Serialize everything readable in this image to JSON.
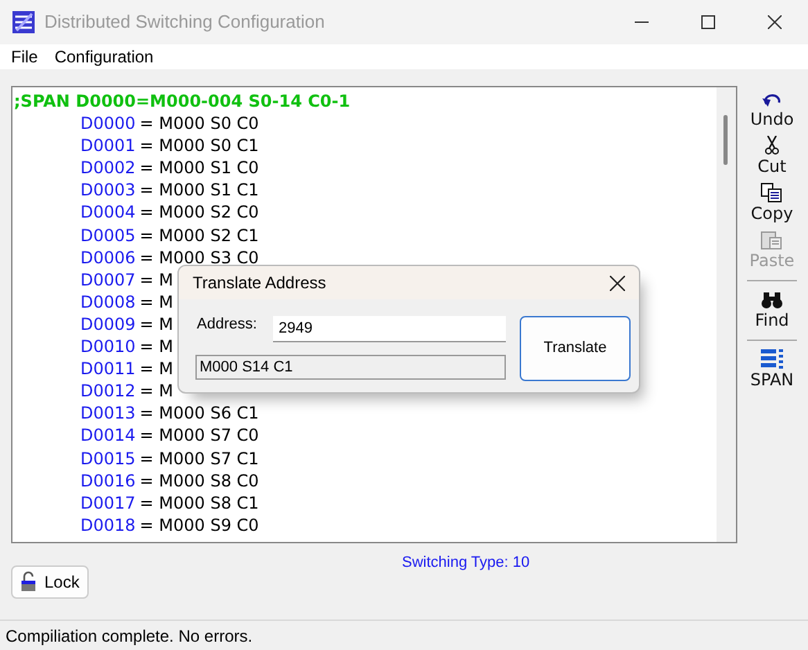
{
  "window": {
    "title": "Distributed Switching Configuration"
  },
  "menu": [
    {
      "label": "File"
    },
    {
      "label": "Configuration"
    }
  ],
  "editor": {
    "header": ";SPAN D0000=M000-004 S0-14 C0-1",
    "lines": [
      {
        "address": "D0000",
        "value": "= M000 S0 C0"
      },
      {
        "address": "D0001",
        "value": "= M000 S0 C1"
      },
      {
        "address": "D0002",
        "value": "= M000 S1 C0"
      },
      {
        "address": "D0003",
        "value": "= M000 S1 C1"
      },
      {
        "address": "D0004",
        "value": "= M000 S2 C0"
      },
      {
        "address": "D0005",
        "value": "= M000 S2 C1"
      },
      {
        "address": "D0006",
        "value": "= M000 S3 C0"
      },
      {
        "address": "D0007",
        "value": "= M"
      },
      {
        "address": "D0008",
        "value": "= M"
      },
      {
        "address": "D0009",
        "value": "= M"
      },
      {
        "address": "D0010",
        "value": "= M"
      },
      {
        "address": "D0011",
        "value": "= M"
      },
      {
        "address": "D0012",
        "value": "= M"
      },
      {
        "address": "D0013",
        "value": "= M000 S6 C1"
      },
      {
        "address": "D0014",
        "value": "= M000 S7 C0"
      },
      {
        "address": "D0015",
        "value": "= M000 S7 C1"
      },
      {
        "address": "D0016",
        "value": "= M000 S8 C0"
      },
      {
        "address": "D0017",
        "value": "= M000 S8 C1"
      },
      {
        "address": "D0018",
        "value": "= M000 S9 C0"
      }
    ]
  },
  "toolbar": [
    {
      "kind": "undo",
      "label": "Undo",
      "disabled": false
    },
    {
      "kind": "cut",
      "label": "Cut",
      "disabled": false
    },
    {
      "kind": "copy",
      "label": "Copy",
      "disabled": false
    },
    {
      "kind": "paste",
      "label": "Paste",
      "disabled": true
    },
    {
      "kind": "find",
      "label": "Find",
      "disabled": false
    },
    {
      "kind": "span",
      "label": "SPAN",
      "disabled": false
    }
  ],
  "lock_button": {
    "label": "Lock"
  },
  "switching_type": "Switching Type:  10",
  "status_bar": "Compiliation complete.  No errors.",
  "dialog": {
    "title": "Translate Address",
    "address_label": "Address:",
    "address_value": "2949",
    "result": "M000 S14 C1",
    "button": "Translate"
  }
}
